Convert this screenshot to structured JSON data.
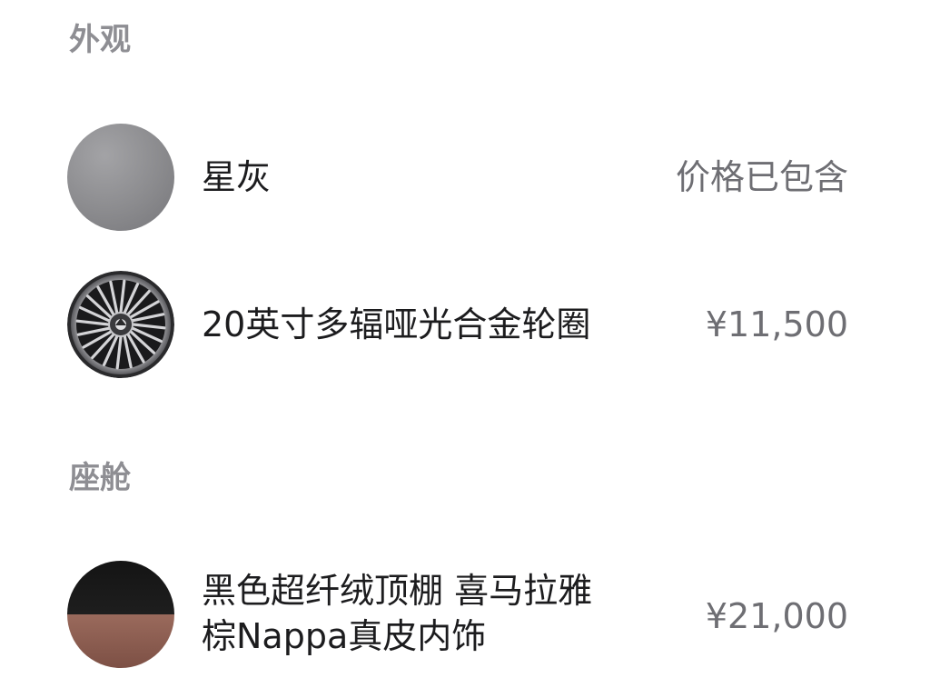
{
  "sections": [
    {
      "title": "外观",
      "items": [
        {
          "name": "星灰",
          "price": "价格已包含",
          "swatch": "gray-circle"
        },
        {
          "name": "20英寸多辐哑光合金轮圈",
          "price": "¥11,500",
          "swatch": "wheel-icon"
        }
      ]
    },
    {
      "title": "座舱",
      "items": [
        {
          "name_line1": "黑色超纤绒顶棚 喜马拉雅",
          "name_line2": "棕Nappa真皮内饰",
          "price": "¥21,000",
          "swatch": "interior-circle"
        }
      ]
    }
  ],
  "colors": {
    "section_title": "#8e8e93",
    "item_text": "#1c1c1e",
    "price_text": "#6e6e73",
    "star_gray": "#8b8b8e",
    "interior_black": "#1a1a1a",
    "interior_brown": "#8a5a4e"
  }
}
